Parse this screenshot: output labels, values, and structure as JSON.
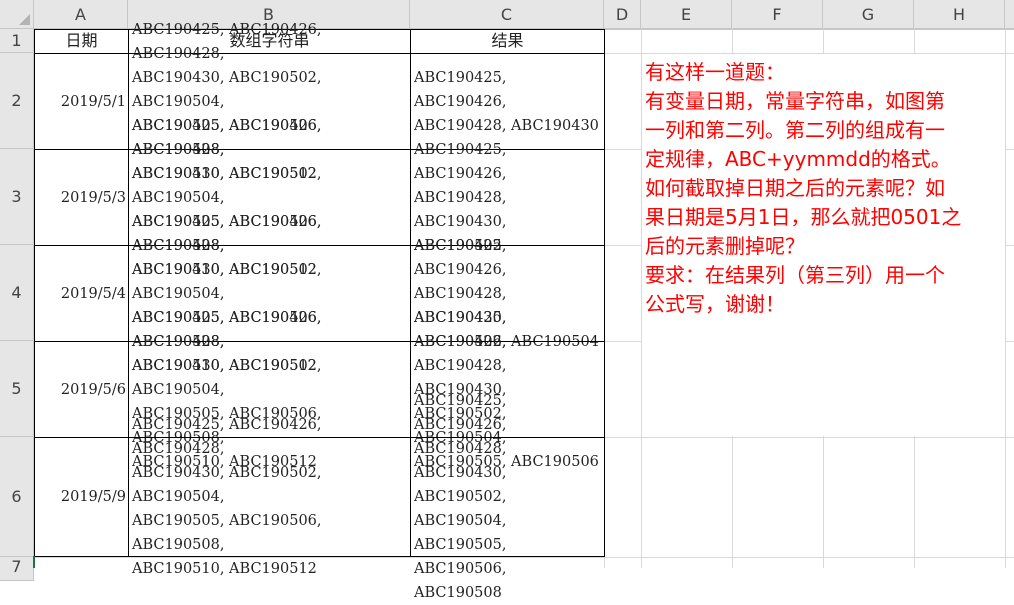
{
  "columns": [
    "A",
    "B",
    "C",
    "D",
    "E",
    "F",
    "G",
    "H"
  ],
  "rows": [
    "1",
    "2",
    "3",
    "4",
    "5",
    "6",
    "7"
  ],
  "headers": {
    "date": "日期",
    "array_string": "数组字符串",
    "result": "结果"
  },
  "table": [
    {
      "date": "2019/5/1",
      "array_lines": [
        "ABC190425, ABC190426, ABC190428,",
        "ABC190430, ABC190502, ABC190504,",
        "ABC190505, ABC190506, ABC190508,",
        "ABC190510, ABC190512"
      ],
      "result_lines": [
        "ABC190425, ABC190426,",
        "ABC190428, ABC190430"
      ]
    },
    {
      "date": "2019/5/3",
      "array_lines": [
        "ABC190425, ABC190426, ABC190428,",
        "ABC190430, ABC190502, ABC190504,",
        "ABC190505, ABC190506, ABC190508,",
        "ABC190510, ABC190512"
      ],
      "result_lines": [
        "ABC190425, ABC190426,",
        "ABC190428, ABC190430,",
        "ABC190502"
      ]
    },
    {
      "date": "2019/5/4",
      "array_lines": [
        "ABC190425, ABC190426, ABC190428,",
        "ABC190430, ABC190502, ABC190504,",
        "ABC190505, ABC190506, ABC190508,",
        "ABC190510, ABC190512"
      ],
      "result_lines": [
        "ABC190425, ABC190426,",
        "ABC190428, ABC190430,",
        "ABC190502, ABC190504"
      ]
    },
    {
      "date": "2019/5/6",
      "array_lines": [
        "ABC190425, ABC190426, ABC190428,",
        "ABC190430, ABC190502, ABC190504,",
        "ABC190505, ABC190506, ABC190508,",
        "ABC190510, ABC190512"
      ],
      "result_lines": [
        "ABC190425, ABC190426,",
        "ABC190428, ABC190430,",
        "ABC190502, ABC190504,",
        "ABC190505, ABC190506"
      ]
    },
    {
      "date": "2019/5/9",
      "array_lines": [
        "ABC190425, ABC190426, ABC190428,",
        "ABC190430, ABC190502, ABC190504,",
        "ABC190505, ABC190506, ABC190508,",
        "ABC190510, ABC190512"
      ],
      "result_lines": [
        "ABC190425, ABC190426,",
        "ABC190428, ABC190430,",
        "ABC190502, ABC190504,",
        "ABC190505, ABC190506,",
        "ABC190508"
      ]
    }
  ],
  "note_lines": [
    "有这样一道题：",
    "有变量日期，常量字符串，如图第",
    "一列和第二列。第二列的组成有一",
    "定规律，ABC+yymmdd的格式。",
    "如何截取掉日期之后的元素呢？如",
    "果日期是5月1日，那么就把0501之",
    "后的元素删掉呢？",
    "要求：在结果列（第三列）用一个",
    "公式写，谢谢！"
  ],
  "colors": {
    "note_text": "#ff0000",
    "header_bg": "#e6e6e6",
    "gridline": "#d9d9d9",
    "selection_accent": "#217346"
  }
}
